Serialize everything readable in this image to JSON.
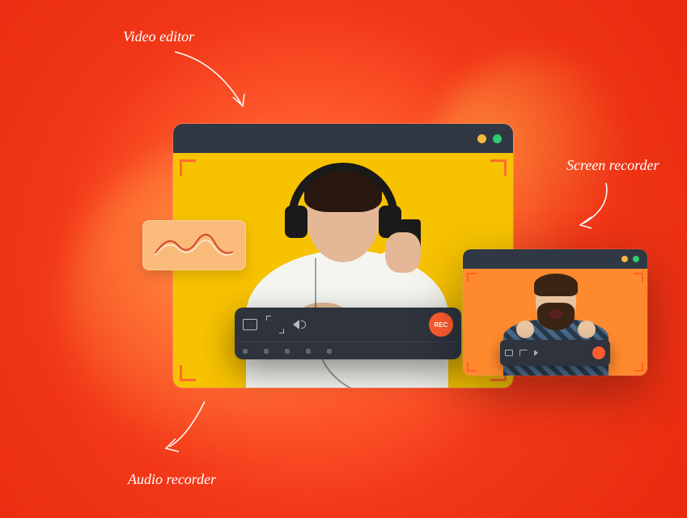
{
  "labels": {
    "video_editor": "Video editor",
    "screen_recorder": "Screen recorder",
    "audio_recorder": "Audio recorder"
  },
  "rec_bar": {
    "button_text": "REC"
  },
  "colors": {
    "amber_dot": "#f6b73c",
    "green_dot": "#2ecc71",
    "rec_orange": "#ff5b2e"
  }
}
